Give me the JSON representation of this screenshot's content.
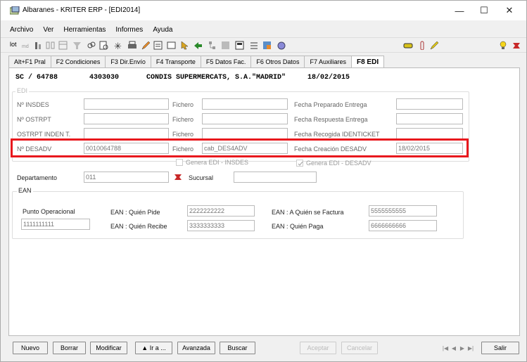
{
  "window": {
    "title": "Albaranes - KRITER ERP -  [EDI2014]"
  },
  "menu": [
    "Archivo",
    "Ver",
    "Herramientas",
    "Informes",
    "Ayuda"
  ],
  "toolbar": {
    "lot_label": "lot"
  },
  "tabs": [
    "Alt+F1 Pral",
    "F2 Condiciones",
    "F3 Dir.Envío",
    "F4 Transporte",
    "F5 Datos Fac.",
    "F6 Otros Datos",
    "F7 Auxiliares",
    "F8 EDI"
  ],
  "header": {
    "series": "SC / 64788",
    "code": "4303030",
    "client": "CONDIS SUPERMERCATS, S.A.\"MADRID\"",
    "date": "18/02/2015"
  },
  "edi": {
    "group_label": "EDI",
    "rows": [
      {
        "label": "Nº INSDES",
        "value": "",
        "fichero_label": "Fichero",
        "fichero": "",
        "date_label": "Fecha Preparado Entrega",
        "date": ""
      },
      {
        "label": "Nº OSTRPT",
        "value": "",
        "fichero_label": "Fichero",
        "fichero": "",
        "date_label": "Fecha Respuesta Entrega",
        "date": ""
      },
      {
        "label": "OSTRPT INDEN T.",
        "value": "",
        "fichero_label": "Fichero",
        "fichero": "",
        "date_label": "Fecha Recogida IDENTICKET",
        "date": ""
      },
      {
        "label": "Nº DESADV",
        "value": "0010064788",
        "fichero_label": "Fichero",
        "fichero": "cab_DES4ADV",
        "date_label": "Fecha Creación DESADV",
        "date": "18/02/2015"
      }
    ],
    "genera_insdes": "Genera EDI - INSDES",
    "genera_desadv": "Genera EDI - DESADV"
  },
  "departamento": {
    "label": "Departamento",
    "value": "011"
  },
  "sucursal": {
    "label": "Sucursal",
    "value": ""
  },
  "ean": {
    "group_label": "EAN",
    "punto_label": "Punto Operacional",
    "punto_value": "1111111111",
    "quien_pide_label": "EAN : Quién Pide",
    "quien_pide": "2222222222",
    "quien_recibe_label": "EAN : Quién Recibe",
    "quien_recibe": "3333333333",
    "quien_factura_label": "EAN : A Quién se Factura",
    "quien_factura": "5555555555",
    "quien_paga_label": "EAN : Quién Paga",
    "quien_paga": "6666666666"
  },
  "buttons": {
    "nuevo": "Nuevo",
    "borrar": "Borrar",
    "modificar": "Modificar",
    "ira": "▲ Ir a ...",
    "avanzada": "Avanzada",
    "buscar": "Buscar",
    "aceptar": "Aceptar",
    "cancelar": "Cancelar",
    "salir": "Salir"
  },
  "colors": {
    "highlight": "#e8181d"
  }
}
